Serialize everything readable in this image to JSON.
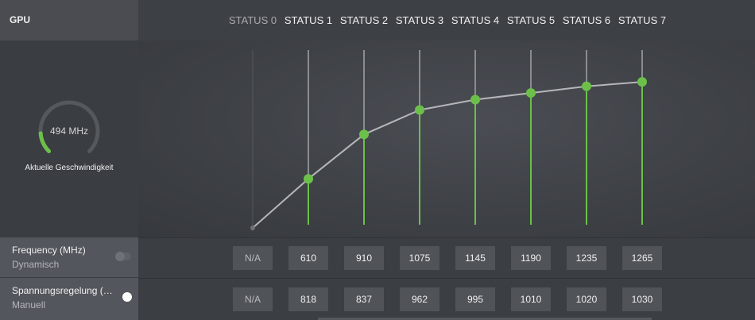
{
  "left": {
    "header_title": "GPU",
    "gauge": {
      "value_text": "494 MHz",
      "caption": "Aktuelle Geschwindigkeit",
      "fraction": 0.15,
      "accent": "#6cc04a"
    }
  },
  "states": [
    "STATUS 0",
    "STATUS 1",
    "STATUS 2",
    "STATUS 3",
    "STATUS 4",
    "STATUS 5",
    "STATUS 6",
    "STATUS 7"
  ],
  "rows": [
    {
      "label": "Frequency (MHz)",
      "sub": "Dynamisch",
      "toggle_on": false,
      "values": [
        "N/A",
        "610",
        "910",
        "1075",
        "1145",
        "1190",
        "1235",
        "1265"
      ]
    },
    {
      "label": "Spannungsregelung (…",
      "sub": "Manuell",
      "toggle_on": true,
      "values": [
        "N/A",
        "818",
        "837",
        "962",
        "995",
        "1010",
        "1020",
        "1030"
      ]
    }
  ],
  "chart_data": {
    "type": "line",
    "categories": [
      "STATUS 0",
      "STATUS 1",
      "STATUS 2",
      "STATUS 3",
      "STATUS 4",
      "STATUS 5",
      "STATUS 6",
      "STATUS 7"
    ],
    "series": [
      {
        "values": [
          null,
          610,
          910,
          1075,
          1145,
          1190,
          1235,
          1265
        ]
      }
    ],
    "ylim": [
      300,
      1480
    ],
    "colors": {
      "point": "#6cc04a",
      "line": "#b4b6ba",
      "track": "#8a8c90"
    }
  }
}
